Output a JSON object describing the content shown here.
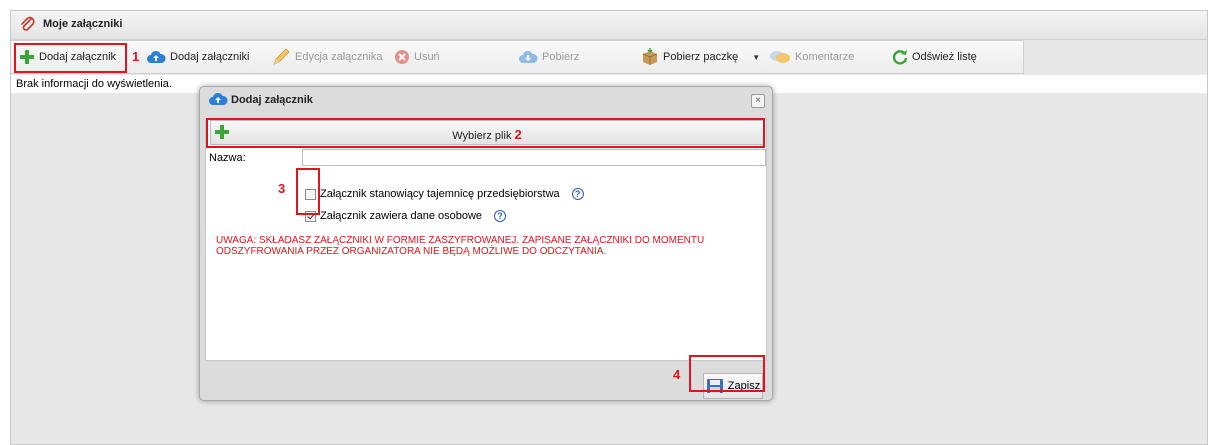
{
  "panel": {
    "title": "Moje załączniki"
  },
  "toolbar": {
    "add_attachment": "Dodaj załącznik",
    "add_attachments": "Dodaj załączniki",
    "edit_attachment": "Edycja załącznika",
    "delete": "Usuń",
    "download": "Pobierz",
    "download_package": "Pobierz paczkę",
    "comments": "Komentarze",
    "refresh": "Odśwież listę"
  },
  "grid": {
    "empty_text": "Brak informacji do wyświetlenia."
  },
  "dialog": {
    "title": "Dodaj załącznik",
    "choose_file": "Wybierz plik",
    "name_label": "Nazwa:",
    "name_value": "",
    "checkbox_trade_secret": {
      "label": "Załącznik stanowiący tajemnicę przedsiębiorstwa",
      "checked": false
    },
    "checkbox_personal_data": {
      "label": "Załącznik zawiera dane osobowe",
      "checked": true
    },
    "warning": "UWAGA: SKŁADASZ ZAŁĄCZNIKI W FORMIE ZASZYFROWANEJ. ZAPISANE ZAŁĄCZNIKI DO MOMENTU ODSZYFROWANIA PRZEZ ORGANIZATORA NIE BĘDĄ MOŻLIWE DO ODCZYTANIA.",
    "save": "Zapisz",
    "close": "×"
  },
  "annotations": {
    "n1": "1",
    "n2": "2",
    "n3": "3",
    "n4": "4"
  },
  "colors": {
    "highlight": "#e0141b",
    "green": "#3aa63a",
    "blue": "#2b7fd4"
  }
}
